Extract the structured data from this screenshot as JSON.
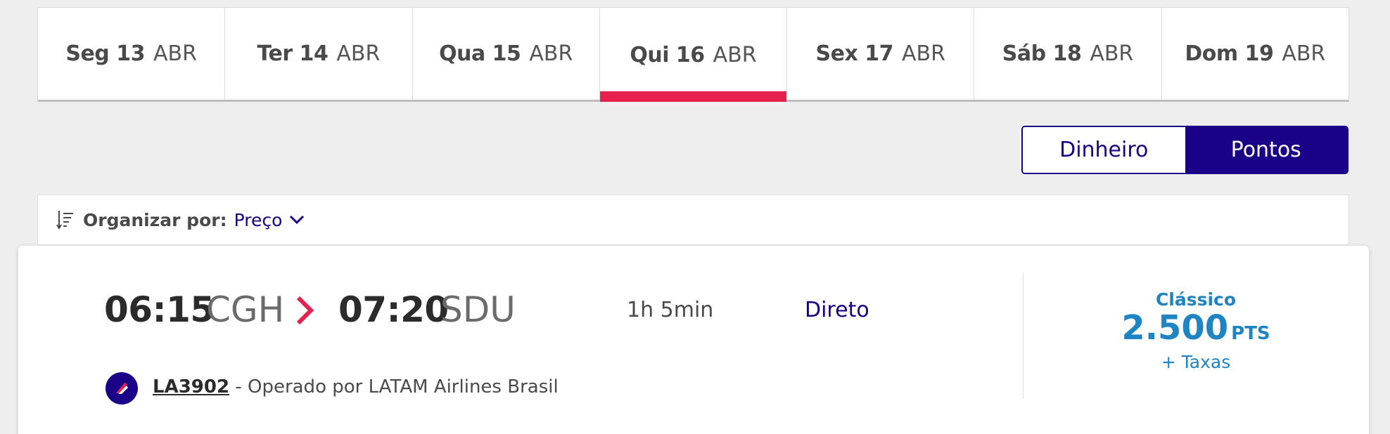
{
  "date_tabs": [
    {
      "day": "Seg 13",
      "month": "ABR",
      "active": false
    },
    {
      "day": "Ter 14",
      "month": "ABR",
      "active": false
    },
    {
      "day": "Qua 15",
      "month": "ABR",
      "active": false
    },
    {
      "day": "Qui 16",
      "month": "ABR",
      "active": true
    },
    {
      "day": "Sex 17",
      "month": "ABR",
      "active": false
    },
    {
      "day": "Sáb 18",
      "month": "ABR",
      "active": false
    },
    {
      "day": "Dom 19",
      "month": "ABR",
      "active": false
    }
  ],
  "currency_toggle": {
    "options": [
      "Dinheiro",
      "Pontos"
    ],
    "selected": "Pontos"
  },
  "sort": {
    "label": "Organizar por:",
    "value": "Preço"
  },
  "flight": {
    "departure_time": "06:15",
    "departure_airport": "CGH",
    "arrival_time": "07:20",
    "arrival_airport": "SDU",
    "duration": "1h 5min",
    "stops": "Direto",
    "flight_number": "LA3902",
    "operator_text": " - Operado por LATAM Airlines Brasil",
    "fare": {
      "brand": "Clássico",
      "price": "2.500",
      "unit": "PTS",
      "taxes": "+ Taxas"
    }
  },
  "colors": {
    "accent_red": "#e6214e",
    "brand_indigo": "#1b0088",
    "price_blue": "#1f84c3"
  }
}
